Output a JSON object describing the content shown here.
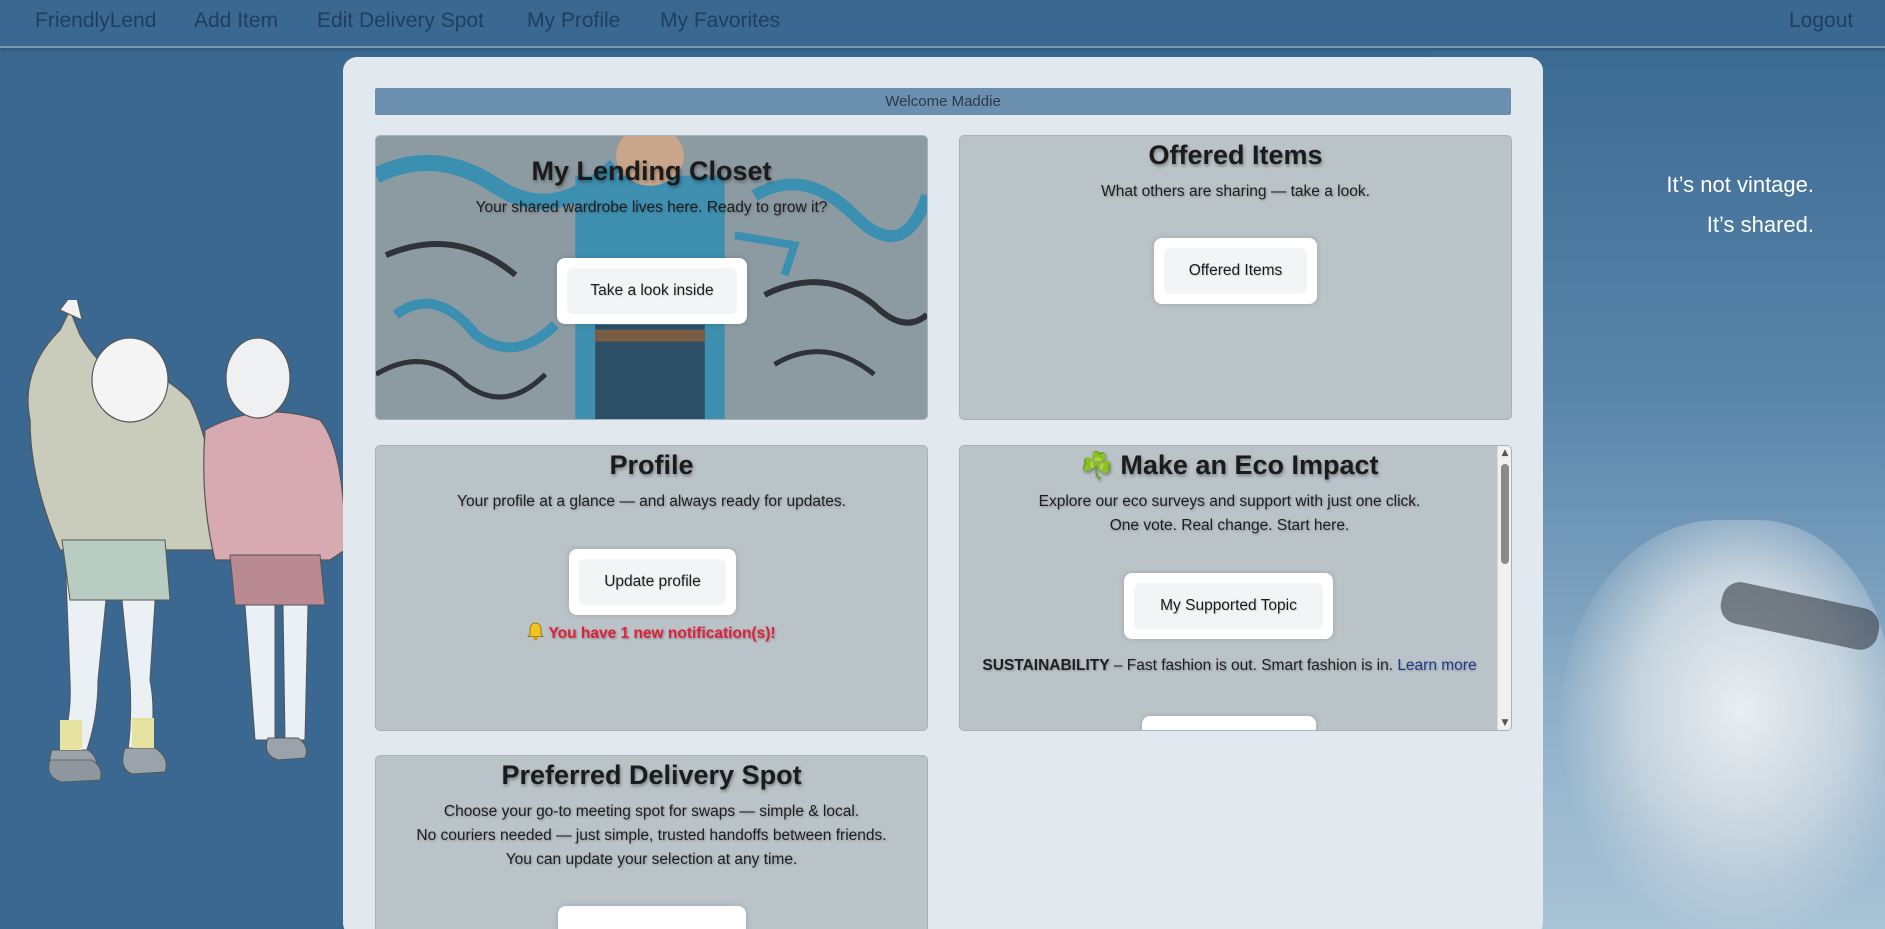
{
  "nav": {
    "brand": "FriendlyLend",
    "links": [
      "Add Item",
      "Edit Delivery Spot",
      "My Profile",
      "My Favorites"
    ],
    "logout": "Logout"
  },
  "tagline": {
    "line1": "It’s not vintage.",
    "line2": "It’s shared."
  },
  "welcome": "Welcome Maddie",
  "closet": {
    "title": "My Lending Closet",
    "text": "Your shared wardrobe lives here. Ready to grow it?",
    "button": "Take a look inside"
  },
  "offered": {
    "title": "Offered Items",
    "text": "What others are sharing — take a look.",
    "button": "Offered Items"
  },
  "profile": {
    "title": "Profile",
    "text": "Your profile at a glance — and always ready for updates.",
    "button": "Update profile",
    "notification": "You have 1 new notification(s)!"
  },
  "eco": {
    "icon": "☘️",
    "title": "Make an Eco Impact",
    "line1": "Explore our eco surveys and support with just one click.",
    "line2": "One vote. Real change. Start here.",
    "button": "My Supported Topic",
    "topic_label": "SUSTAINABILITY",
    "topic_text": " – Fast fashion is out. Smart fashion is in. ",
    "learn_more": "Learn more"
  },
  "delivery": {
    "title": "Preferred Delivery Spot",
    "line1": "Choose your go-to meeting spot for swaps — simple & local.",
    "line2": "No couriers needed — just simple, trusted handoffs between friends.",
    "line3": "You can update your selection at any time."
  },
  "colors": {
    "background": "#3a6890",
    "panel": "#e2e9ee",
    "card": "#bac3c8",
    "notification": "#e0203a",
    "link": "#1a3a8a"
  }
}
